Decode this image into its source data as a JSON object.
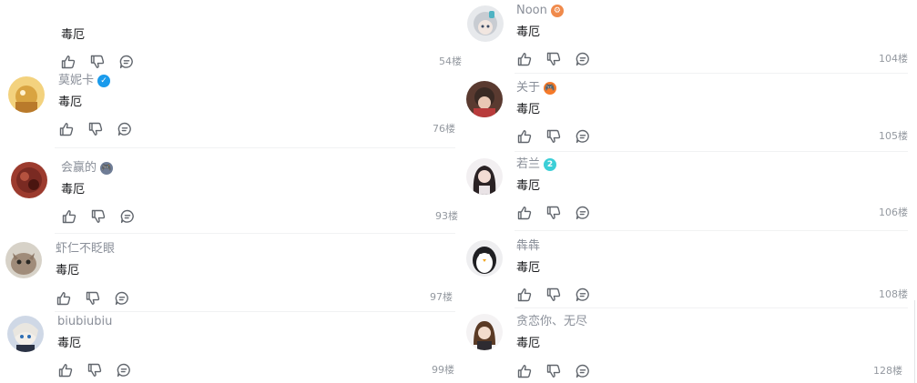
{
  "left": [
    {
      "username": "",
      "text": "毒厄",
      "floor": "54楼",
      "badge": "",
      "badge_color": "",
      "avatar": "none"
    },
    {
      "username": "莫妮卡",
      "text": "毒厄",
      "floor": "76楼",
      "badge": "✓",
      "badge_color": "#1a9bec",
      "avatar": "warm-yellow"
    },
    {
      "username": "会赢的",
      "text": "毒厄",
      "floor": "93楼",
      "badge": "🎮",
      "badge_color": "#6f7d96",
      "avatar": "dark-red"
    },
    {
      "username": "虾仁不眨眼",
      "text": "毒厄",
      "floor": "97楼",
      "badge": "",
      "badge_color": "",
      "avatar": "cat"
    },
    {
      "username": "biubiubiu",
      "text": "毒厄",
      "floor": "99楼",
      "badge": "",
      "badge_color": "",
      "avatar": "anime-white"
    }
  ],
  "right": [
    {
      "username": "Noon",
      "text": "毒厄",
      "floor": "104楼",
      "badge": "⚙",
      "badge_color": "#f08a4b",
      "avatar": "silver-hair"
    },
    {
      "username": "关于",
      "text": "毒厄",
      "floor": "105楼",
      "badge": "🎮",
      "badge_color": "#f57a2a",
      "avatar": "dark-hair"
    },
    {
      "username": "若兰",
      "text": "毒厄",
      "floor": "106楼",
      "badge": "2",
      "badge_color": "#3ccfd7",
      "avatar": "black-hair"
    },
    {
      "username": "犇犇",
      "text": "毒厄",
      "floor": "108楼",
      "badge": "",
      "badge_color": "",
      "avatar": "penguin"
    },
    {
      "username": "贪恋你、无尽",
      "text": "毒厄",
      "floor": "128楼",
      "badge": "",
      "badge_color": "",
      "avatar": "brown-hair"
    }
  ],
  "icons": {
    "like": "thumbs-up-icon",
    "dislike": "thumbs-down-icon",
    "reply": "reply-bubble-icon"
  }
}
